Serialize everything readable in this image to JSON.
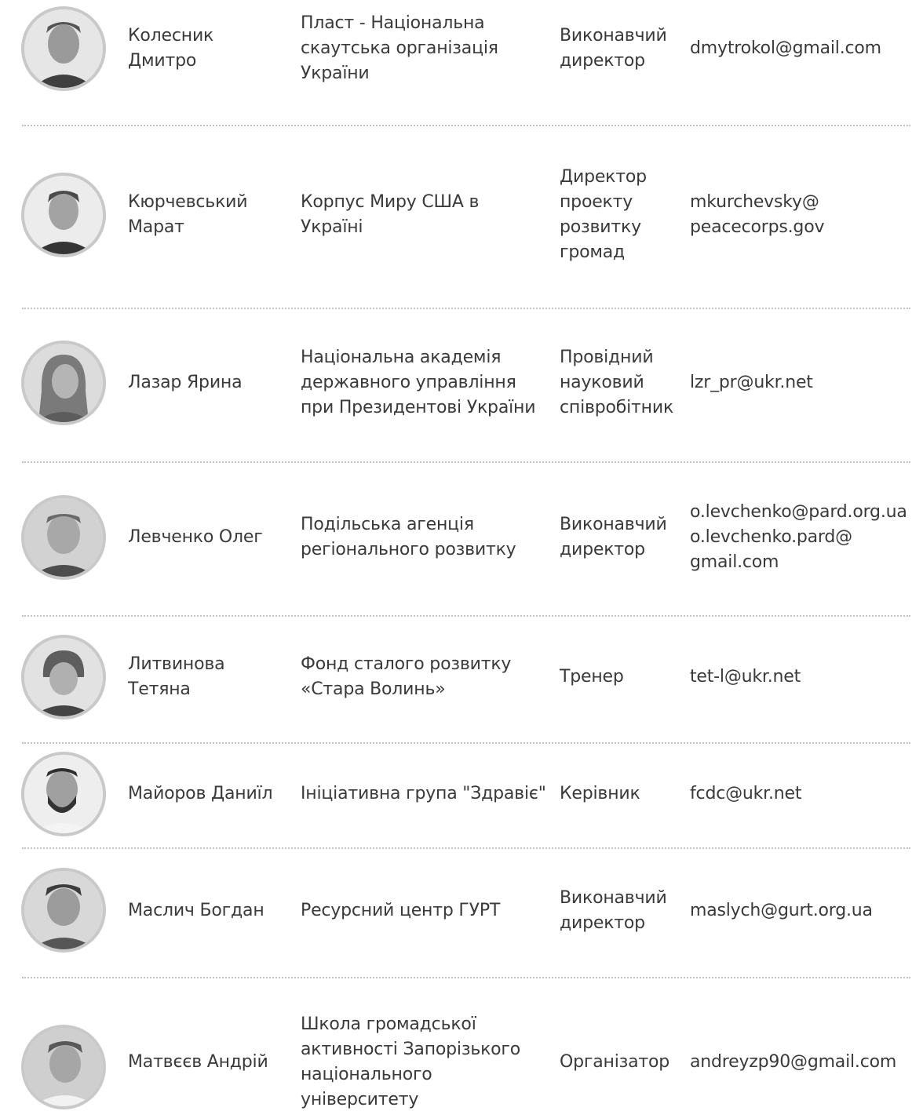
{
  "rows": [
    {
      "name": "Колесник\nДмитро",
      "organization": "Пласт -  Національна\nскаутська організація\nУкраїни",
      "position": "Виконавчий\nдиректор",
      "email": "dmytrokol@gmail.com"
    },
    {
      "name": "Кюрчевський\nМарат",
      "organization": "Корпус Миру США в\nУкраїні",
      "position": "Директор\nпроекту\nрозвитку\nгромад",
      "email": "mkurchevsky@\npeacecorps.gov"
    },
    {
      "name": "Лазар Ярина",
      "organization": "Національна академія\nдержавного управління\nпри Президентові України",
      "position": "Провідний\nнауковий\nспівробітник",
      "email": "lzr_pr@ukr.net"
    },
    {
      "name": "Левченко Олег",
      "organization": "Подільська агенція\nрегіонального розвитку",
      "position": "Виконавчий\nдиректор",
      "email": "o.levchenko@pard.org.ua\no.levchenko.pard@\ngmail.com"
    },
    {
      "name": "Литвинова\nТетяна",
      "organization": "Фонд сталого розвитку\n«Стара Волинь»",
      "position": "Тренер",
      "email": "tet-l@ukr.net"
    },
    {
      "name": "Майоров Даниїл",
      "organization": "Ініціативна група \"Здравіє\"",
      "position": "Керівник",
      "email": "fcdc@ukr.net"
    },
    {
      "name": "Маслич Богдан",
      "organization": "Ресурсний центр ГУРТ",
      "position": "Виконавчий\nдиректор",
      "email": "maslych@gurt.org.ua"
    },
    {
      "name": "Матвєєв Андрій",
      "organization": "Школа громадської\nактивності Запорізького\nнаціонального\nуніверситету",
      "position": "Організатор",
      "email": "andreyzp90@gmail.com"
    }
  ]
}
